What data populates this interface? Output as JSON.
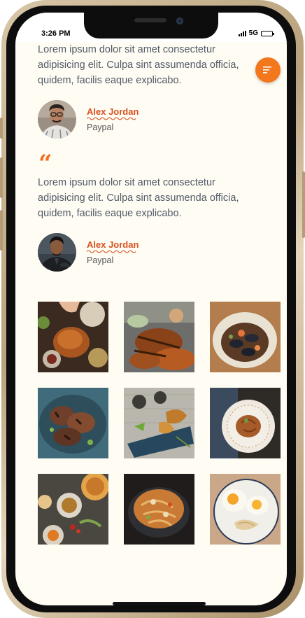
{
  "status_bar": {
    "time": "3:26 PM",
    "network": "5G",
    "battery_level": 0.9
  },
  "testimonials": [
    {
      "text": "Lorem ipsum dolor sit amet consectetur adipisicing elit. Culpa sint assumenda officia, quidem, facilis eaque explicabo.",
      "author_name": "Alex Jordan",
      "author_company": "Paypal"
    },
    {
      "text": "Lorem ipsum dolor sit amet consectetur adipisicing elit. Culpa sint assumenda officia, quidem, facilis eaque explicabo.",
      "author_name": "Alex Jordan",
      "author_company": "Paypal"
    }
  ],
  "quote_icon": "“",
  "icons": {
    "menu_button": "menu-icon"
  },
  "colors": {
    "accent": "#f26f22",
    "accent_dark": "#d6521f",
    "page_bg": "#fffcf4",
    "text": "#505a66"
  },
  "gallery": [
    "roast chicken dinner spread",
    "grilled chicken skewers",
    "mussels seafood platter",
    "roasted chicken pieces",
    "fried pastries board with dips",
    "pasta bowl",
    "sharing plates table",
    "noodle stir fry bowl",
    "fried eggs with pasta"
  ]
}
